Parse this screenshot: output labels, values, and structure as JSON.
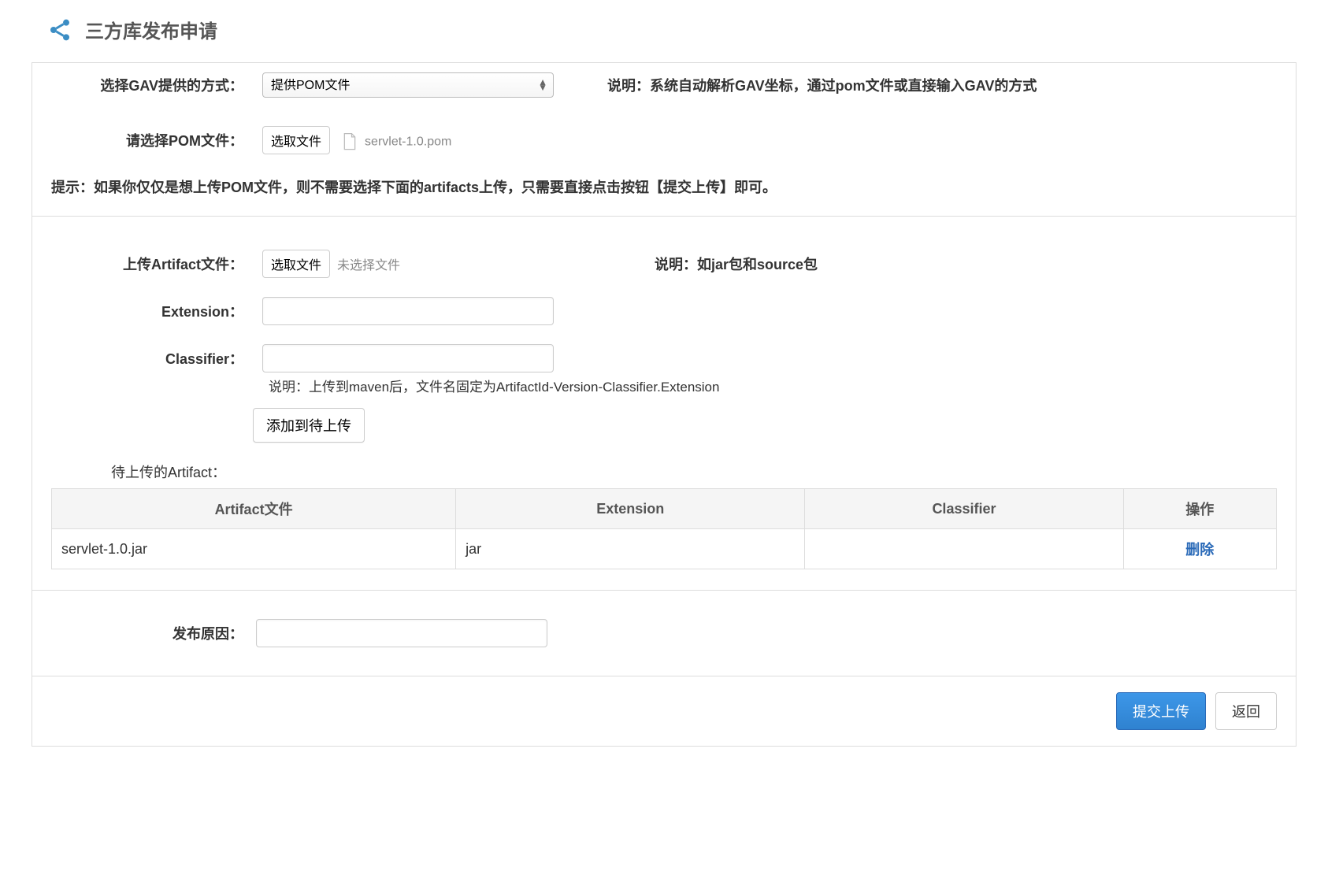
{
  "header": {
    "title": "三方库发布申请"
  },
  "gav": {
    "label": "选择GAV提供的方式：",
    "selected": "提供POM文件",
    "description": "说明：系统自动解析GAV坐标，通过pom文件或直接输入GAV的方式"
  },
  "pom": {
    "label": "请选择POM文件：",
    "button": "选取文件",
    "filename": "servlet-1.0.pom"
  },
  "hint": "提示：如果你仅仅是想上传POM文件，则不需要选择下面的artifacts上传，只需要直接点击按钮【提交上传】即可。",
  "artifact": {
    "label": "上传Artifact文件：",
    "button": "选取文件",
    "no_file": "未选择文件",
    "description": "说明：如jar包和source包"
  },
  "extension": {
    "label": "Extension：",
    "value": ""
  },
  "classifier": {
    "label": "Classifier：",
    "value": "",
    "hint": "说明：上传到maven后，文件名固定为ArtifactId-Version-Classifier.Extension"
  },
  "add_button": "添加到待上传",
  "pending_label": "待上传的Artifact：",
  "table": {
    "headers": {
      "file": "Artifact文件",
      "extension": "Extension",
      "classifier": "Classifier",
      "operation": "操作"
    },
    "rows": [
      {
        "file": "servlet-1.0.jar",
        "extension": "jar",
        "classifier": "",
        "delete": "删除"
      }
    ]
  },
  "reason": {
    "label": "发布原因：",
    "value": ""
  },
  "buttons": {
    "submit": "提交上传",
    "back": "返回"
  }
}
